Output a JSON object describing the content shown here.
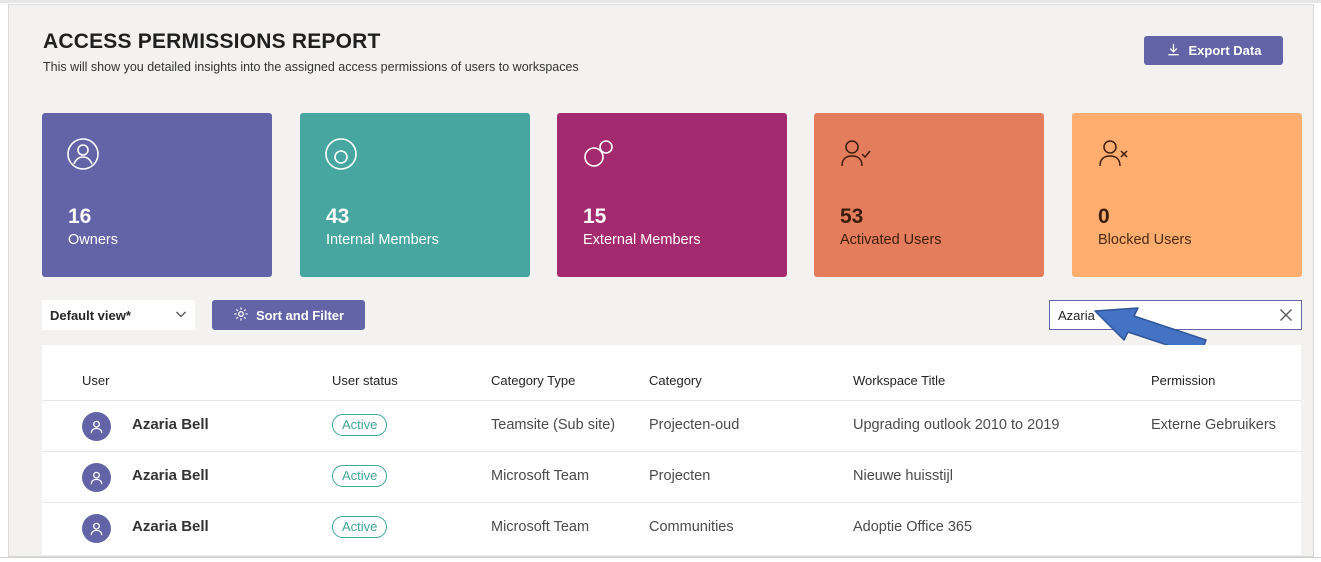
{
  "header": {
    "title": "ACCESS PERMISSIONS REPORT",
    "subtitle": "This will show you detailed insights into the assigned access permissions of users to workspaces",
    "export_label": "Export Data"
  },
  "cards": [
    {
      "count": "16",
      "label": "Owners",
      "color": "#6264a7",
      "icon": "user-circle-icon"
    },
    {
      "count": "43",
      "label": "Internal Members",
      "color": "#48a6a0",
      "icon": "internal-member-icon"
    },
    {
      "count": "15",
      "label": "External Members",
      "color": "#a32a6e",
      "icon": "external-member-icon"
    },
    {
      "count": "53",
      "label": "Activated Users",
      "color": "#e37d5c",
      "icon": "user-check-icon"
    },
    {
      "count": "0",
      "label": "Blocked Users",
      "color": "#ffae70",
      "icon": "user-block-icon"
    }
  ],
  "toolbar": {
    "view_label": "Default view*",
    "sort_label": "Sort and Filter",
    "search_value": "Azaria"
  },
  "table": {
    "headers": [
      "User",
      "User status",
      "Category Type",
      "Category",
      "Workspace Title",
      "Permission"
    ],
    "rows": [
      {
        "user": "Azaria Bell",
        "status": "Active",
        "category_type": "Teamsite (Sub site)",
        "category": "Projecten-oud",
        "workspace": "Upgrading outlook 2010 to 2019",
        "permission": "Externe Gebruikers"
      },
      {
        "user": "Azaria Bell",
        "status": "Active",
        "category_type": "Microsoft Team",
        "category": "Projecten",
        "workspace": "Nieuwe huisstijl",
        "permission": ""
      },
      {
        "user": "Azaria Bell",
        "status": "Active",
        "category_type": "Microsoft Team",
        "category": "Communities",
        "workspace": "Adoptie Office 365",
        "permission": ""
      }
    ]
  },
  "colors": {
    "accent": "#6264a7",
    "status_active": "#3fa796",
    "annotation_arrow": "#4472c4"
  }
}
